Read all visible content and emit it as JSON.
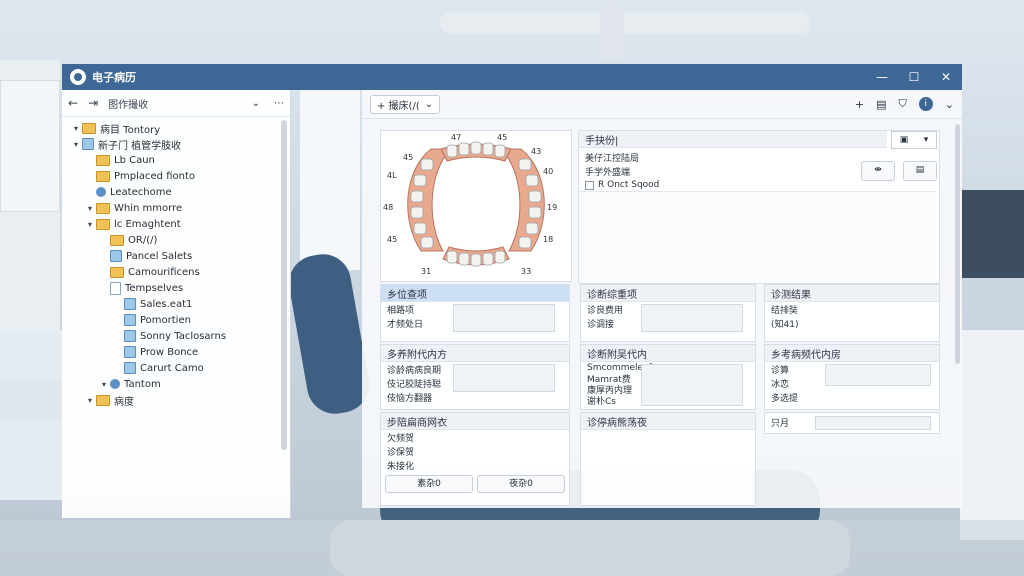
{
  "window": {
    "title": "电子病历",
    "controls": [
      "—",
      "☐",
      "✕"
    ]
  },
  "left": {
    "toolbar": {
      "back": "←",
      "forward": "⇥",
      "path": "图作撮收",
      "more1": "⌄",
      "more2": "⋯"
    },
    "tree": [
      {
        "label": "病目 Tontory",
        "icon": "folder",
        "indent": 0,
        "toggle": "▾"
      },
      {
        "label": "新子门 植管学肢收",
        "icon": "blue",
        "indent": 0,
        "toggle": "▾"
      },
      {
        "label": "Lb Caun",
        "icon": "folder",
        "indent": 1,
        "toggle": ""
      },
      {
        "label": "Pmplaced fionto",
        "icon": "folder",
        "indent": 1,
        "toggle": ""
      },
      {
        "label": "Leatechome",
        "icon": "round",
        "indent": 1,
        "toggle": ""
      },
      {
        "label": "Whin mmorre",
        "icon": "folder",
        "indent": 1,
        "toggle": "▾"
      },
      {
        "label": "lc Emaghtent",
        "icon": "folder",
        "indent": 1,
        "toggle": "▾"
      },
      {
        "label": "OR/(/)",
        "icon": "folder",
        "indent": 2,
        "toggle": ""
      },
      {
        "label": "Pancel Salets",
        "icon": "blue",
        "indent": 2,
        "toggle": ""
      },
      {
        "label": "Camourificens",
        "icon": "folder",
        "indent": 2,
        "toggle": ""
      },
      {
        "label": "Tempselves",
        "icon": "doc",
        "indent": 2,
        "toggle": ""
      },
      {
        "label": "Sales.eat1",
        "icon": "blue",
        "indent": 3,
        "toggle": ""
      },
      {
        "label": "Pomortien",
        "icon": "blue",
        "indent": 3,
        "toggle": ""
      },
      {
        "label": "Sonny Taclosarns",
        "icon": "blue",
        "indent": 3,
        "toggle": ""
      },
      {
        "label": "Prow Bonce",
        "icon": "blue",
        "indent": 3,
        "toggle": ""
      },
      {
        "label": "Carurt Camo",
        "icon": "blue",
        "indent": 3,
        "toggle": ""
      },
      {
        "label": "Tantom",
        "icon": "round",
        "indent": 2,
        "toggle": "▾"
      },
      {
        "label": "病度",
        "icon": "folder",
        "indent": 1,
        "toggle": "▾"
      }
    ]
  },
  "right": {
    "toolbar": {
      "view_label": "+ 撮床(/(",
      "icons": [
        "+",
        "▤",
        "⛉",
        "i",
        "⌄"
      ]
    },
    "tooth_numbers": [
      "47",
      "45",
      "4L",
      "48",
      "45",
      "40",
      "19",
      "18",
      "31",
      "33",
      "45",
      "43"
    ],
    "notes": {
      "title": "手抉份|",
      "lines": [
        "美仔江控陆局",
        "手学外盛端"
      ],
      "checkbox": "R Onct Sqood"
    },
    "panels": {
      "p1": {
        "title": "乡位查项",
        "rows": [
          "相路项",
          "才频处日"
        ]
      },
      "p2": {
        "title": "诊断综重项",
        "rows": [
          "诊良费用",
          "诊调接"
        ]
      },
      "p3": {
        "title": "诊测结果",
        "rows": [
          "结排奘",
          "(知41)"
        ]
      },
      "p4": {
        "title": "多养附代内方",
        "rows": [
          "诊龄病病良期",
          "伎记胶陡持聪",
          "伎恼方翻器"
        ]
      },
      "p5": {
        "title": "诊断附吴代内",
        "rows": [
          "Smcommeleaf",
          "Mamrat费",
          "康厚丙内理",
          "谢朴Cs"
        ]
      },
      "p6": {
        "title": "乡考病频代内房",
        "rows": [
          "诊算",
          "冰恋",
          "多选提"
        ]
      },
      "p7": {
        "title": "步陪扁商网衣",
        "rows": [
          "欠频贺",
          "诊保贺",
          "朱接化"
        ],
        "btn1": "素杂0",
        "btn2": "夜杂0"
      },
      "p8": {
        "title": "诊停病熊荡夜"
      },
      "p9": {
        "title": "",
        "rows": [
          "只月"
        ]
      }
    }
  }
}
